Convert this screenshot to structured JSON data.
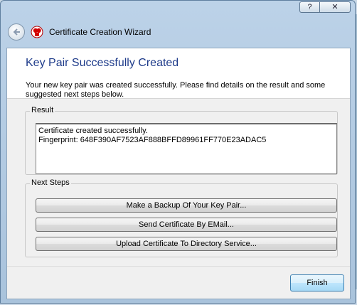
{
  "window": {
    "title": "Certificate Creation Wizard",
    "help_glyph": "?",
    "close_glyph": "✕"
  },
  "header": {
    "title": "Key Pair Successfully Created",
    "description": "Your new key pair was created successfully. Please find details on the result and some suggested next steps below."
  },
  "result": {
    "legend": "Result",
    "line1": "Certificate created successfully.",
    "line2": "Fingerprint: 648F390AF7523AF888BFFD89961FF770E23ADAC5"
  },
  "next_steps": {
    "legend": "Next Steps",
    "backup_label": "Make a Backup Of Your Key Pair...",
    "email_label": "Send Certificate By EMail...",
    "upload_label": "Upload Certificate To Directory Service..."
  },
  "footer": {
    "finish_label": "Finish"
  },
  "icons": {
    "back": "back-arrow-icon",
    "app": "kleopatra-app-icon",
    "help": "help-icon",
    "close": "close-icon"
  },
  "colors": {
    "title_blue": "#1e3b8a",
    "window_frame": "#bcd2e8",
    "finish_button": "#bee6fd"
  }
}
